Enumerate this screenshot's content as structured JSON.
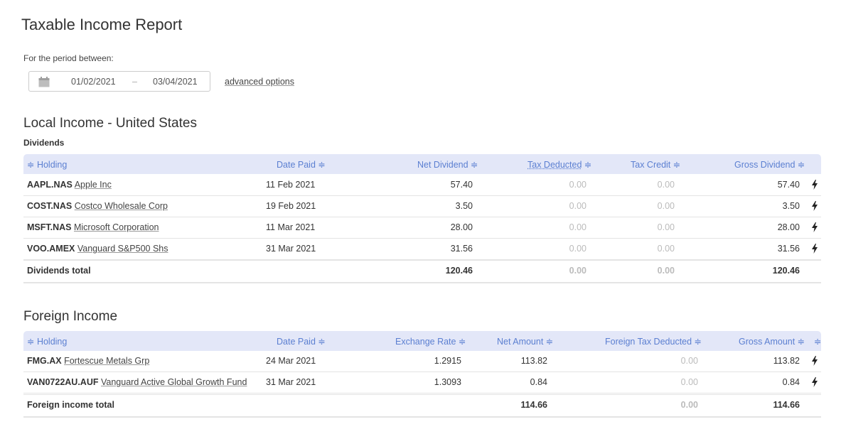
{
  "page": {
    "title": "Taxable Income Report",
    "period_label": "For the period between:",
    "date_start": "01/02/2021",
    "date_separator": "–",
    "date_end": "03/04/2021",
    "advanced_options": "advanced options"
  },
  "local": {
    "section_title": "Local Income - United States",
    "subsection": "Dividends",
    "headers": {
      "holding": "≑ Holding",
      "date_paid": "Date Paid ≑",
      "net_dividend": "Net Dividend ≑",
      "tax_deducted": "Tax Deducted",
      "tax_deducted_sort": "≑",
      "tax_credit": "Tax Credit ≑",
      "gross_dividend": "Gross Dividend ≑"
    },
    "rows": [
      {
        "code": "AAPL.NAS",
        "name": "Apple Inc",
        "date": "11 Feb 2021",
        "net": "57.40",
        "tax_deducted": "0.00",
        "tax_credit": "0.00",
        "gross": "57.40"
      },
      {
        "code": "COST.NAS",
        "name": "Costco Wholesale Corp",
        "date": "19 Feb 2021",
        "net": "3.50",
        "tax_deducted": "0.00",
        "tax_credit": "0.00",
        "gross": "3.50"
      },
      {
        "code": "MSFT.NAS",
        "name": "Microsoft Corporation",
        "date": "11 Mar 2021",
        "net": "28.00",
        "tax_deducted": "0.00",
        "tax_credit": "0.00",
        "gross": "28.00"
      },
      {
        "code": "VOO.AMEX",
        "name": "Vanguard S&P500 Shs",
        "date": "31 Mar 2021",
        "net": "31.56",
        "tax_deducted": "0.00",
        "tax_credit": "0.00",
        "gross": "31.56"
      }
    ],
    "total": {
      "label": "Dividends total",
      "net": "120.46",
      "tax_deducted": "0.00",
      "tax_credit": "0.00",
      "gross": "120.46"
    }
  },
  "foreign": {
    "section_title": "Foreign Income",
    "headers": {
      "holding": "≑ Holding",
      "date_paid": "Date Paid ≑",
      "exchange_rate": "Exchange Rate ≑",
      "net_amount": "Net Amount ≑",
      "foreign_tax": "Foreign Tax Deducted ≑",
      "gross_amount": "Gross Amount ≑",
      "extra_sort": "≑"
    },
    "rows": [
      {
        "code": "FMG.AX",
        "name": "Fortescue Metals Grp",
        "date": "24 Mar 2021",
        "rate": "1.2915",
        "net": "113.82",
        "foreign_tax": "0.00",
        "gross": "113.82"
      },
      {
        "code": "VAN0722AU.AUF",
        "name": "Vanguard Active Global Growth Fund",
        "date": "31 Mar 2021",
        "rate": "1.3093",
        "net": "0.84",
        "foreign_tax": "0.00",
        "gross": "0.84"
      }
    ],
    "total": {
      "label": "Foreign income total",
      "net": "114.66",
      "foreign_tax": "0.00",
      "gross": "114.66"
    }
  },
  "icons": {
    "calendar": "calendar-icon",
    "bolt": "bolt-icon"
  },
  "colors": {
    "header_bg": "#e3e7f8",
    "header_text": "#5b7fd1",
    "muted": "#bbbbbb"
  }
}
